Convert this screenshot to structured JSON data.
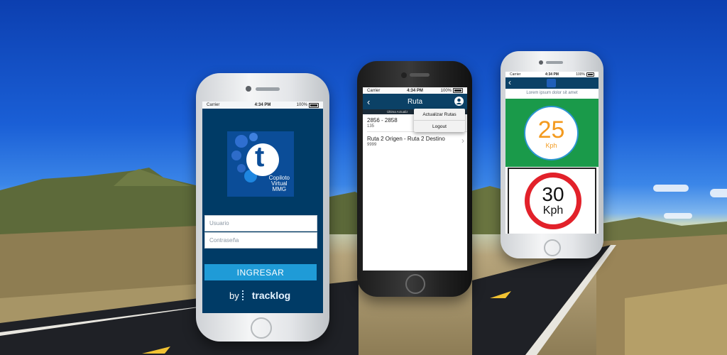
{
  "status_bar": {
    "carrier": "Carrier",
    "time": "4:34 PM",
    "battery": "100%"
  },
  "login_screen": {
    "app_name_lines": [
      "Copiloto",
      "Virtual",
      "MMG"
    ],
    "logo_letter": "t",
    "username_placeholder": "Usuario",
    "password_placeholder": "Contraseña",
    "login_button": "INGRESAR",
    "brand_prefix": "by",
    "brand_name": "tracklog"
  },
  "route_screen": {
    "title": "Ruta",
    "subheader": "Última Actualiz",
    "routes": [
      {
        "name": "2856 - 2858",
        "code": "135"
      },
      {
        "name": "Ruta 2 Origen - Ruta 2 Destino",
        "code": "9999"
      }
    ],
    "menu": [
      "Actualizar Rutas",
      "Logout"
    ]
  },
  "speed_screen": {
    "caption": "Lorem ipsum dolor sit amet",
    "current_speed": "25",
    "current_unit": "Kph",
    "limit_speed": "30",
    "limit_unit": "Kph"
  },
  "colors": {
    "primary": "#0b4166",
    "accent": "#1f9bd7",
    "green": "#1a9a4a",
    "red": "#e2212a",
    "orange": "#f39a1e"
  }
}
